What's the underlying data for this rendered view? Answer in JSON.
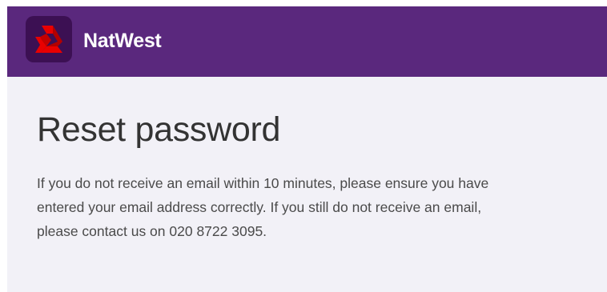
{
  "header": {
    "logo_icon": "natwest-chevrons-logo-icon",
    "brand_name": "NatWest",
    "background_color": "#5a287d",
    "logo_tile_color": "#3c1053",
    "logo_mark_color": "#e90000"
  },
  "main": {
    "title": "Reset password",
    "message": "If you do not receive an email within 10 minutes, please ensure you have entered your email address correctly. If you still do not receive an email, please contact us on 020 8722 3095."
  },
  "colors": {
    "page_background": "#f2f1f7",
    "title_text": "#333333",
    "body_text": "#4a4a4a"
  }
}
